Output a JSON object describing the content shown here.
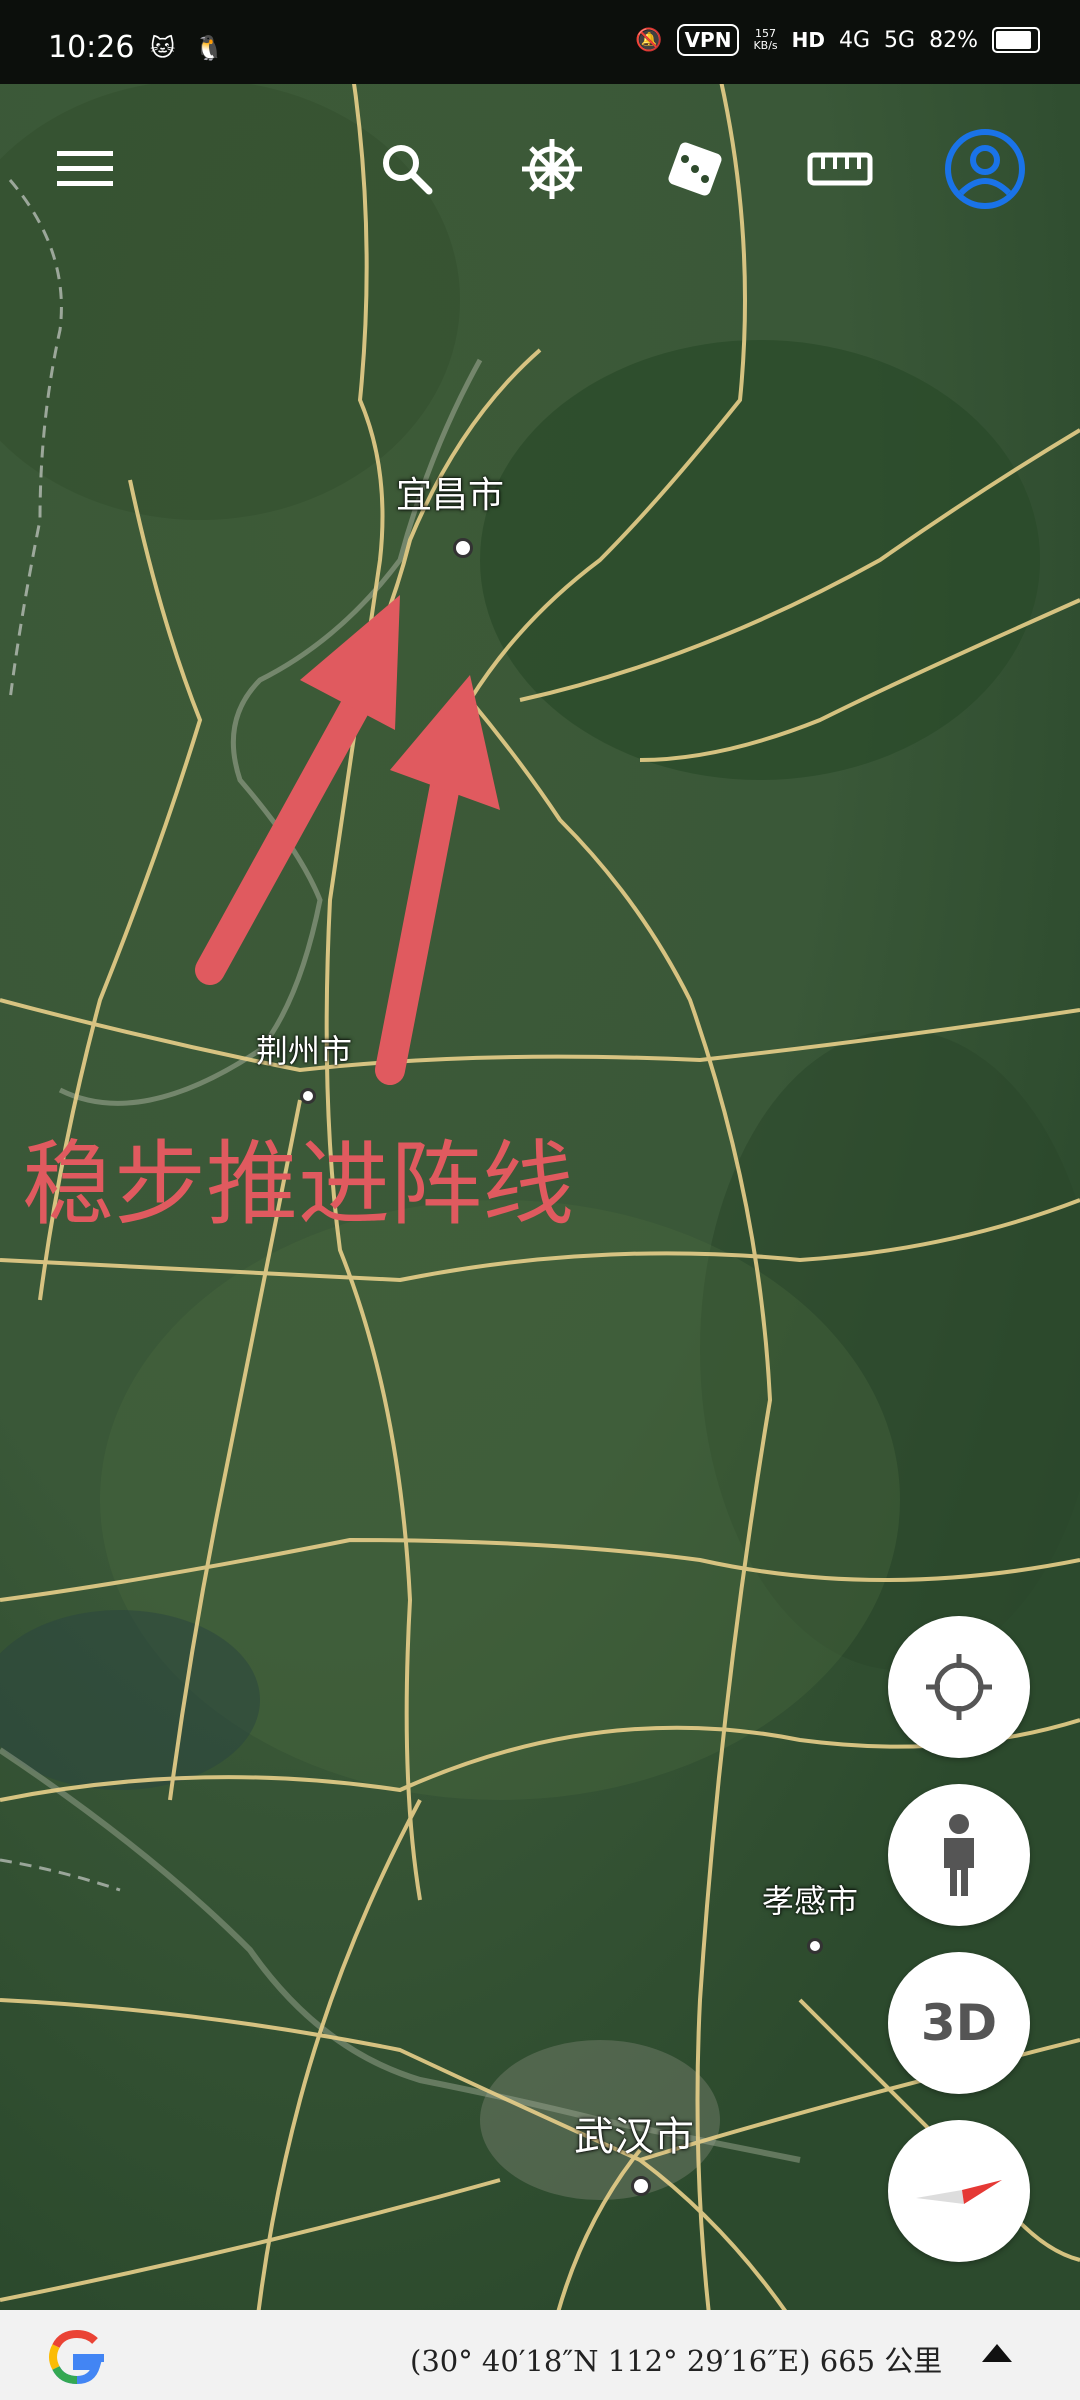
{
  "status_bar": {
    "time": "10:26",
    "net_speed_value": "157",
    "net_speed_unit": "KB/s",
    "vpn": "VPN",
    "hd": "HD",
    "net_4g": "4G",
    "net_5g": "5G",
    "battery": "82%"
  },
  "toolbar": {
    "icons": [
      "menu-icon",
      "search-icon",
      "ship-wheel-icon",
      "dice-icon",
      "ruler-icon",
      "account-icon"
    ],
    "account_color": "#1a73e8"
  },
  "map": {
    "cities": {
      "yichang": "宜昌市",
      "jingzhou": "荆州市",
      "xiaogan": "孝感市",
      "wuhan": "武汉市"
    },
    "overlay_text": "稳步推进阵线",
    "arrow_color": "#e05a5f"
  },
  "controls": {
    "three_d": "3D"
  },
  "bottom_bar": {
    "coordinates": "(30° 40′18″N 112° 29′16″E) 665 公里"
  }
}
